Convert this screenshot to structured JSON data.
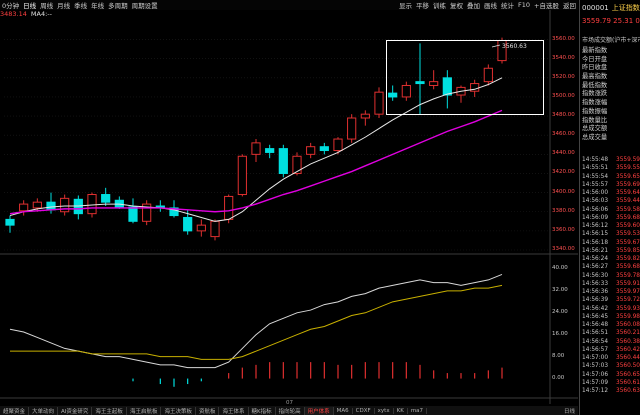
{
  "toolbar": {
    "periods": [
      "0分钟",
      "日线",
      "周线",
      "月线",
      "季线",
      "年线",
      "多周期",
      "周期设置"
    ],
    "active_period": 1,
    "controls": [
      "显示",
      "平移",
      "训练",
      "复权",
      "叠加",
      "画线",
      "统计",
      "F10",
      "+自选股",
      "返回"
    ]
  },
  "ma_bar": {
    "ma_value": "3483.14",
    "ma4_label": "MA4:--"
  },
  "highlight_label": "3560.63",
  "price_ticks": [
    "3560.00",
    "3540.00",
    "3520.00",
    "3500.00",
    "3480.00",
    "3460.00",
    "3440.00",
    "3420.00",
    "3400.00",
    "3380.00",
    "3360.00",
    "3340.00"
  ],
  "indicator_ticks": [
    "40.00",
    "32.00",
    "24.00",
    "16.00",
    "8.00",
    "0.00"
  ],
  "x_label": "07",
  "side": {
    "code": "000001",
    "name": "上证指数",
    "price_line": "3559.79  25.31  0.7",
    "desc": "市场成交额(沪市+深市",
    "menu": [
      "最新指数",
      "今日开盘",
      "昨日收盘",
      "最高指数",
      "最低指数",
      "指数涨跌",
      "指数涨幅",
      "指数振幅",
      "指数量比",
      "总成交额",
      "总成交量"
    ],
    "ticks": [
      {
        "t": "14:55:48",
        "p": "3559.59"
      },
      {
        "t": "14:55:51",
        "p": "3559.55"
      },
      {
        "t": "14:55:54",
        "p": "3559.65"
      },
      {
        "t": "14:55:57",
        "p": "3559.69"
      },
      {
        "t": "14:56:00",
        "p": "3559.64"
      },
      {
        "t": "14:56:03",
        "p": "3559.44"
      },
      {
        "t": "14:56:06",
        "p": "3559.58"
      },
      {
        "t": "14:56:09",
        "p": "3559.68"
      },
      {
        "t": "14:56:12",
        "p": "3559.60"
      },
      {
        "t": "14:56:15",
        "p": "3559.53"
      },
      {
        "t": "14:56:18",
        "p": "3559.67"
      },
      {
        "t": "14:56:21",
        "p": "3559.85"
      },
      {
        "t": "14:56:24",
        "p": "3559.82"
      },
      {
        "t": "14:56:27",
        "p": "3559.68"
      },
      {
        "t": "14:56:30",
        "p": "3559.78"
      },
      {
        "t": "14:56:33",
        "p": "3559.91"
      },
      {
        "t": "14:56:36",
        "p": "3559.97"
      },
      {
        "t": "14:56:39",
        "p": "3559.72"
      },
      {
        "t": "14:56:42",
        "p": "3559.93"
      },
      {
        "t": "14:56:45",
        "p": "3559.98"
      },
      {
        "t": "14:56:48",
        "p": "3560.08"
      },
      {
        "t": "14:56:51",
        "p": "3560.21"
      },
      {
        "t": "14:56:54",
        "p": "3560.38"
      },
      {
        "t": "14:56:57",
        "p": "3560.42"
      },
      {
        "t": "14:57:00",
        "p": "3560.44"
      },
      {
        "t": "14:57:03",
        "p": "3560.50"
      },
      {
        "t": "14:57:06",
        "p": "3560.65"
      },
      {
        "t": "14:57:09",
        "p": "3560.61"
      },
      {
        "t": "14:57:12",
        "p": "3560.63"
      }
    ]
  },
  "bottom_tabs": [
    "超聚资金",
    "大单动向",
    "AI资金研究",
    "海王主起板",
    "海王启航板",
    "海王决策板",
    "资航板",
    "海王体系",
    "糖K指标",
    "指向轮高",
    "用户体系",
    "MA6",
    "CDXF",
    "xytx",
    "KK",
    "ma7"
  ],
  "active_bottom_tab": 10,
  "bottom_right": "日线",
  "colors": {
    "up": "#e03030",
    "down": "#00e0e0",
    "ma_short": "#e8e8e8",
    "ma_long": "#e000e0",
    "ind_white": "#d8d8d8",
    "ind_yellow": "#c8b000"
  },
  "chart_data": {
    "type": "candlestick",
    "ylim": [
      3340,
      3570
    ],
    "candles": [
      {
        "o": 3372,
        "h": 3376,
        "l": 3358,
        "c": 3366
      },
      {
        "o": 3381,
        "h": 3392,
        "l": 3376,
        "c": 3388
      },
      {
        "o": 3384,
        "h": 3394,
        "l": 3380,
        "c": 3390
      },
      {
        "o": 3390,
        "h": 3400,
        "l": 3378,
        "c": 3382
      },
      {
        "o": 3380,
        "h": 3398,
        "l": 3376,
        "c": 3394
      },
      {
        "o": 3393,
        "h": 3397,
        "l": 3372,
        "c": 3378
      },
      {
        "o": 3378,
        "h": 3400,
        "l": 3374,
        "c": 3398
      },
      {
        "o": 3398,
        "h": 3405,
        "l": 3386,
        "c": 3390
      },
      {
        "o": 3392,
        "h": 3396,
        "l": 3383,
        "c": 3385
      },
      {
        "o": 3385,
        "h": 3394,
        "l": 3368,
        "c": 3370
      },
      {
        "o": 3370,
        "h": 3392,
        "l": 3366,
        "c": 3388
      },
      {
        "o": 3386,
        "h": 3392,
        "l": 3380,
        "c": 3384
      },
      {
        "o": 3384,
        "h": 3392,
        "l": 3374,
        "c": 3376
      },
      {
        "o": 3374,
        "h": 3382,
        "l": 3356,
        "c": 3360
      },
      {
        "o": 3360,
        "h": 3372,
        "l": 3354,
        "c": 3366
      },
      {
        "o": 3354,
        "h": 3372,
        "l": 3350,
        "c": 3370
      },
      {
        "o": 3372,
        "h": 3398,
        "l": 3368,
        "c": 3396
      },
      {
        "o": 3398,
        "h": 3440,
        "l": 3396,
        "c": 3438
      },
      {
        "o": 3440,
        "h": 3456,
        "l": 3432,
        "c": 3452
      },
      {
        "o": 3446,
        "h": 3450,
        "l": 3436,
        "c": 3442
      },
      {
        "o": 3446,
        "h": 3450,
        "l": 3416,
        "c": 3420
      },
      {
        "o": 3420,
        "h": 3442,
        "l": 3418,
        "c": 3438
      },
      {
        "o": 3440,
        "h": 3452,
        "l": 3436,
        "c": 3448
      },
      {
        "o": 3448,
        "h": 3452,
        "l": 3440,
        "c": 3444
      },
      {
        "o": 3444,
        "h": 3458,
        "l": 3440,
        "c": 3456
      },
      {
        "o": 3456,
        "h": 3482,
        "l": 3452,
        "c": 3478
      },
      {
        "o": 3478,
        "h": 3486,
        "l": 3470,
        "c": 3482
      },
      {
        "o": 3482,
        "h": 3510,
        "l": 3478,
        "c": 3505
      },
      {
        "o": 3504,
        "h": 3512,
        "l": 3496,
        "c": 3500
      },
      {
        "o": 3500,
        "h": 3516,
        "l": 3496,
        "c": 3512
      },
      {
        "o": 3516,
        "h": 3556,
        "l": 3482,
        "c": 3514
      },
      {
        "o": 3512,
        "h": 3528,
        "l": 3508,
        "c": 3516
      },
      {
        "o": 3520,
        "h": 3528,
        "l": 3488,
        "c": 3502
      },
      {
        "o": 3502,
        "h": 3512,
        "l": 3494,
        "c": 3510
      },
      {
        "o": 3506,
        "h": 3518,
        "l": 3500,
        "c": 3514
      },
      {
        "o": 3516,
        "h": 3534,
        "l": 3512,
        "c": 3530
      },
      {
        "o": 3538,
        "h": 3562,
        "l": 3535,
        "c": 3559
      }
    ],
    "ma_short": [
      3376,
      3380,
      3383,
      3385,
      3386,
      3386,
      3387,
      3388,
      3388,
      3386,
      3385,
      3384,
      3382,
      3378,
      3374,
      3370,
      3372,
      3380,
      3392,
      3404,
      3414,
      3422,
      3430,
      3436,
      3442,
      3450,
      3458,
      3467,
      3476,
      3484,
      3492,
      3498,
      3503,
      3506,
      3508,
      3513,
      3520
    ],
    "ma_long": [
      3378,
      3380,
      3381,
      3382,
      3383,
      3383,
      3384,
      3384,
      3384,
      3384,
      3384,
      3384,
      3383,
      3382,
      3381,
      3380,
      3381,
      3384,
      3388,
      3393,
      3398,
      3402,
      3407,
      3412,
      3417,
      3422,
      3428,
      3434,
      3440,
      3446,
      3452,
      3458,
      3464,
      3469,
      3474,
      3480,
      3486
    ],
    "indicator_white": [
      18,
      17,
      15,
      13,
      11,
      10,
      9,
      8,
      8,
      7,
      6,
      5,
      5,
      4,
      4,
      4,
      6,
      11,
      16,
      20,
      22,
      24,
      25,
      27,
      28,
      30,
      31,
      33,
      34,
      35,
      36,
      35,
      35,
      34,
      35,
      36,
      38
    ],
    "indicator_yellow": [
      10,
      10,
      10,
      10,
      10,
      10,
      9,
      9,
      9,
      9,
      9,
      8,
      8,
      8,
      7,
      7,
      7,
      8,
      10,
      12,
      14,
      16,
      18,
      19,
      21,
      23,
      24,
      26,
      28,
      29,
      30,
      31,
      32,
      32,
      33,
      33,
      34
    ],
    "indicator_bars": [
      0,
      0,
      0,
      0,
      0,
      0,
      0,
      0,
      0,
      -1,
      0,
      -2,
      -3,
      -2,
      -1,
      0,
      2,
      4,
      5,
      6,
      6,
      6,
      6,
      6,
      5,
      5,
      6,
      6,
      6,
      6,
      5,
      3,
      2,
      2,
      2,
      3,
      4
    ],
    "ind_ylim": [
      -6,
      44
    ]
  }
}
